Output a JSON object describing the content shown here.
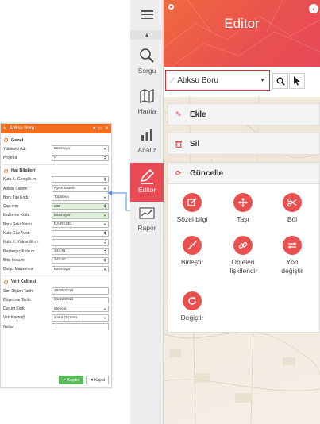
{
  "colors": {
    "accent": "#e9504f",
    "form_header": "#f36f1e",
    "save_green": "#5cb85c"
  },
  "form": {
    "title": "Atıksu Boru",
    "window_buttons": [
      "▾",
      "▭",
      "✕"
    ],
    "sections": {
      "genel": "Genel",
      "hat": "Hat Bilgileri",
      "kalite": "Veri Kalitesi"
    },
    "genel_rows": [
      {
        "label": "Yüklenici Adı",
        "value": "Bilinmiyor",
        "type": "select"
      },
      {
        "label": "Proje Id",
        "value": "0",
        "type": "spin"
      }
    ],
    "hat_rows": [
      {
        "label": "Kutu K. Genişlik.m",
        "value": "",
        "type": "spin"
      },
      {
        "label": "Atıksu Sistem",
        "value": "Ayrık Sistem",
        "type": "select"
      },
      {
        "label": "Boru Tipi Kodu",
        "value": "Toplayıcı",
        "type": "select"
      },
      {
        "label": "Çap.mm",
        "value": "600",
        "type": "spin",
        "green": true
      },
      {
        "label": "Malzeme Kodu",
        "value": "Bilinmiyor",
        "type": "select",
        "green": true
      },
      {
        "label": "Boru Şekil Kodu",
        "value": "DAIRESEL",
        "type": "select"
      },
      {
        "label": "Kutu Göz Adeti",
        "value": "",
        "type": "spin"
      },
      {
        "label": "Kutu K. Yükseklik.m",
        "value": "",
        "type": "spin"
      },
      {
        "label": "Başlangıç Kotu.m",
        "value": "343,91",
        "type": "spin"
      },
      {
        "label": "Bitiş Kotu.m",
        "value": "343,62",
        "type": "spin"
      },
      {
        "label": "Dolgu Malzemesi",
        "value": "Bilinmiyor",
        "type": "select"
      }
    ],
    "kalite_rows": [
      {
        "label": "Son Ölçüm Tarihi",
        "value": "28/05/2019",
        "type": "date"
      },
      {
        "label": "Döşenme Tarihi",
        "value": "31/12/2014",
        "type": "date"
      },
      {
        "label": "Durum Kodu",
        "value": "Mevcut",
        "type": "select"
      },
      {
        "label": "Veri Kaynağı",
        "value": "Saha Ölçümü",
        "type": "select"
      },
      {
        "label": "Notlar",
        "value": "",
        "type": "text"
      }
    ],
    "save_label": "Kaydet",
    "close_label": "Kapat"
  },
  "nav": {
    "items": [
      {
        "label": "Sorgu",
        "icon": "search-icon"
      },
      {
        "label": "Harita",
        "icon": "map-icon"
      },
      {
        "label": "Analiz",
        "icon": "chart-icon"
      },
      {
        "label": "Editor",
        "icon": "pencil-icon",
        "active": true
      },
      {
        "label": "Rapor",
        "icon": "report-icon"
      }
    ]
  },
  "editor": {
    "title": "Editor",
    "layer_select": "Atıksu Boru",
    "bars": {
      "ekle": "Ekle",
      "sil": "Sil",
      "guncelle": "Güncelle"
    },
    "ops": [
      {
        "label": "Sözel bilgi",
        "icon": "edit-icon"
      },
      {
        "label": "Taşı",
        "icon": "move-icon"
      },
      {
        "label": "Böl",
        "icon": "scissors-icon"
      },
      {
        "label": "Birleştir",
        "icon": "merge-icon"
      },
      {
        "label": "Objeleri\nilişkilendir",
        "icon": "link-icon"
      },
      {
        "label": "Yön\ndeğiştir",
        "icon": "swap-icon"
      },
      {
        "label": "Değiştir",
        "icon": "refresh-icon"
      }
    ]
  }
}
